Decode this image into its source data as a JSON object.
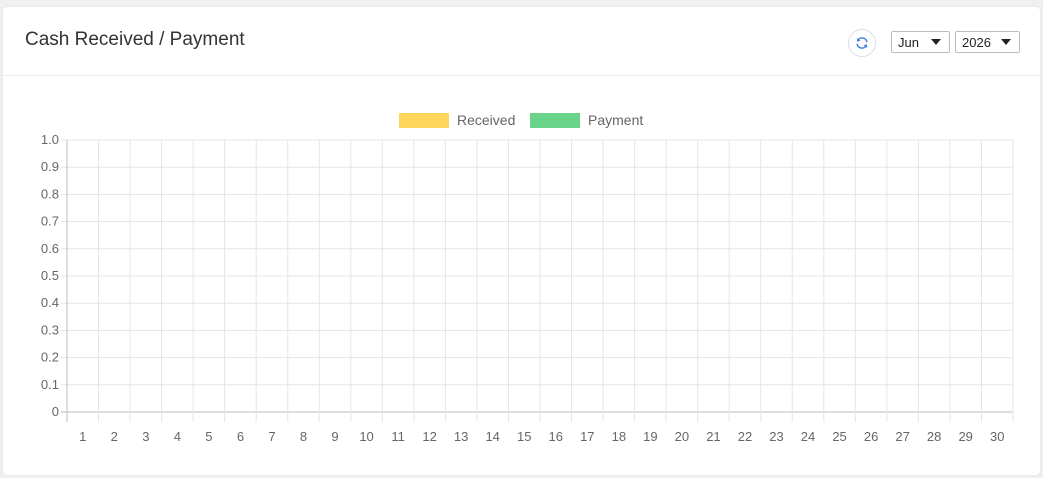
{
  "card": {
    "title": "Cash Received / Payment"
  },
  "controls": {
    "refresh_icon": "refresh-icon",
    "month_value": "Jun",
    "year_value": "2026"
  },
  "colors": {
    "received": "#ffd65c",
    "payment": "#6ad38a",
    "grid": "#e5e5e5",
    "axis": "#bdbdbd",
    "tick_text": "#666666",
    "accent": "#3b7ddd"
  },
  "chart_data": {
    "type": "bar",
    "categories": [
      "1",
      "2",
      "3",
      "4",
      "5",
      "6",
      "7",
      "8",
      "9",
      "10",
      "11",
      "12",
      "13",
      "14",
      "15",
      "16",
      "17",
      "18",
      "19",
      "20",
      "21",
      "22",
      "23",
      "24",
      "25",
      "26",
      "27",
      "28",
      "29",
      "30"
    ],
    "series": [
      {
        "name": "Received",
        "values": [
          0,
          0,
          0,
          0,
          0,
          0,
          0,
          0,
          0,
          0,
          0,
          0,
          0,
          0,
          0,
          0,
          0,
          0,
          0,
          0,
          0,
          0,
          0,
          0,
          0,
          0,
          0,
          0,
          0,
          0
        ]
      },
      {
        "name": "Payment",
        "values": [
          0,
          0,
          0,
          0,
          0,
          0,
          0,
          0,
          0,
          0,
          0,
          0,
          0,
          0,
          0,
          0,
          0,
          0,
          0,
          0,
          0,
          0,
          0,
          0,
          0,
          0,
          0,
          0,
          0,
          0
        ]
      }
    ],
    "yticks": [
      "0",
      "0.1",
      "0.2",
      "0.3",
      "0.4",
      "0.5",
      "0.6",
      "0.7",
      "0.8",
      "0.9",
      "1.0"
    ],
    "ylim": [
      0,
      1
    ],
    "grid": true,
    "legend_position": "top-center"
  }
}
